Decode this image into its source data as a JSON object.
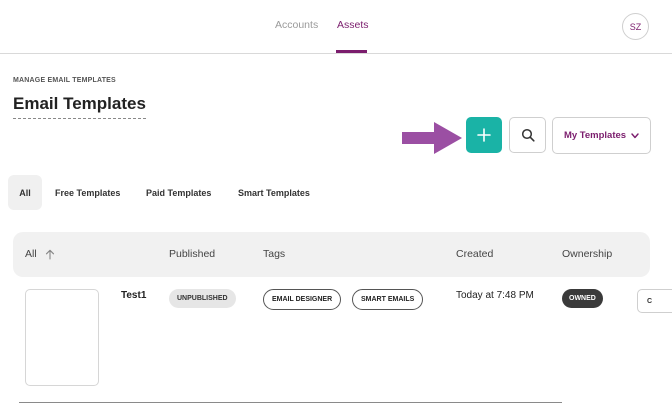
{
  "nav": {
    "tabs": [
      {
        "label": "Accounts",
        "active": false
      },
      {
        "label": "Assets",
        "active": true
      }
    ],
    "avatar_initials": "SZ"
  },
  "header": {
    "eyebrow": "MANAGE EMAIL TEMPLATES",
    "title": "Email Templates"
  },
  "toolbar": {
    "add_icon": "plus-icon",
    "search_icon": "search-icon",
    "filter_label": "My Templates",
    "filter_icon": "chevron-down-icon"
  },
  "filter_tabs": [
    {
      "label": "All",
      "active": true
    },
    {
      "label": "Free Templates",
      "active": false
    },
    {
      "label": "Paid Templates",
      "active": false
    },
    {
      "label": "Smart Templates",
      "active": false
    }
  ],
  "table": {
    "columns": [
      "All",
      "Published",
      "Tags",
      "Created",
      "Ownership"
    ],
    "sort_icon": "arrow-up-icon",
    "rows": [
      {
        "name": "Test1",
        "status": "UNPUBLISHED",
        "tags": [
          "EMAIL DESIGNER",
          "SMART EMAILS"
        ],
        "created": "Today at 7:48 PM",
        "ownership": "OWNED",
        "action_label": "C"
      }
    ]
  },
  "colors": {
    "brand": "#7b1d6d",
    "accent": "#1ab3a6",
    "annotation_arrow": "#9b4fa3"
  }
}
